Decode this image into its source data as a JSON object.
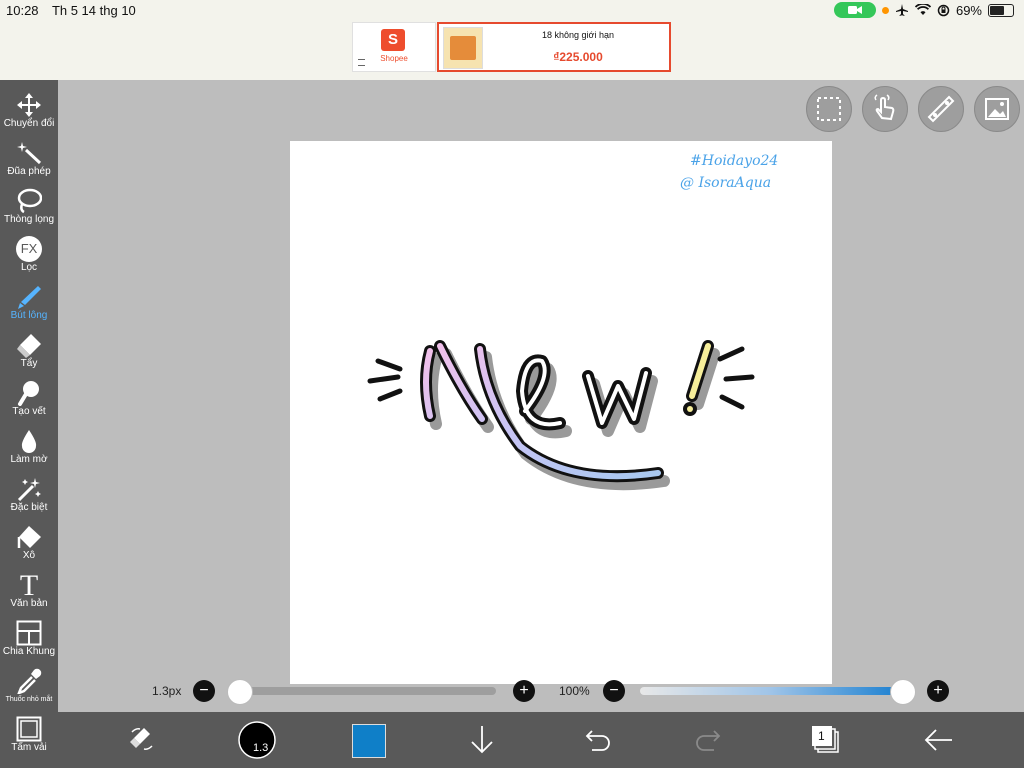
{
  "status": {
    "time": "10:28",
    "date": "Th 5 14 thg 10",
    "battery": "69%"
  },
  "ad": {
    "shop_label": "Shopee",
    "shop_glyph": "S",
    "product_title": "18 không giới hạn",
    "product_price": "₫225.000"
  },
  "sidebar": {
    "items": [
      {
        "label": "Chuyển đổi",
        "icon": "move-icon"
      },
      {
        "label": "Đũa phép",
        "icon": "magic-wand-icon"
      },
      {
        "label": "Thòng lọng",
        "icon": "lasso-icon"
      },
      {
        "label": "Lọc",
        "icon": "fx-filter-icon",
        "glyph": "FX"
      },
      {
        "label": "Bút lông",
        "icon": "brush-icon",
        "active": true
      },
      {
        "label": "Tẩy",
        "icon": "eraser-icon"
      },
      {
        "label": "Tạo vết",
        "icon": "smudge-icon"
      },
      {
        "label": "Làm mờ",
        "icon": "blur-drop-icon"
      },
      {
        "label": "Đặc biệt",
        "icon": "sparkle-icon"
      },
      {
        "label": "Xô",
        "icon": "bucket-icon"
      },
      {
        "label": "Văn bản",
        "icon": "text-icon",
        "glyph": "T"
      },
      {
        "label": "Chia Khung",
        "icon": "frame-divider-icon"
      },
      {
        "label": "Thuốc nhỏ mắt",
        "icon": "eyedropper-icon"
      },
      {
        "label": "Tấm vải",
        "icon": "canvas-icon"
      }
    ]
  },
  "top_tools": [
    {
      "icon": "selection-icon"
    },
    {
      "icon": "gesture-hand-icon"
    },
    {
      "icon": "ruler-icon"
    },
    {
      "icon": "image-icon"
    }
  ],
  "canvas": {
    "watermark_line1": "#Hoidayo24",
    "watermark_line2": "@ IsoraAqua",
    "artwork_text": "New!"
  },
  "brush_size": {
    "value": "1.3px",
    "fraction": 0.02,
    "minus": "−",
    "plus": "+"
  },
  "opacity": {
    "value": "100%",
    "fraction": 1.0,
    "minus": "−",
    "plus": "+"
  },
  "bottom": {
    "brush_preview_value": "1.3",
    "layer_count": "1",
    "color": "#0f7fc8"
  },
  "colors": {
    "sidebar": "#595959",
    "accent": "#56b4ff",
    "workspace": "#bdbdbd"
  }
}
